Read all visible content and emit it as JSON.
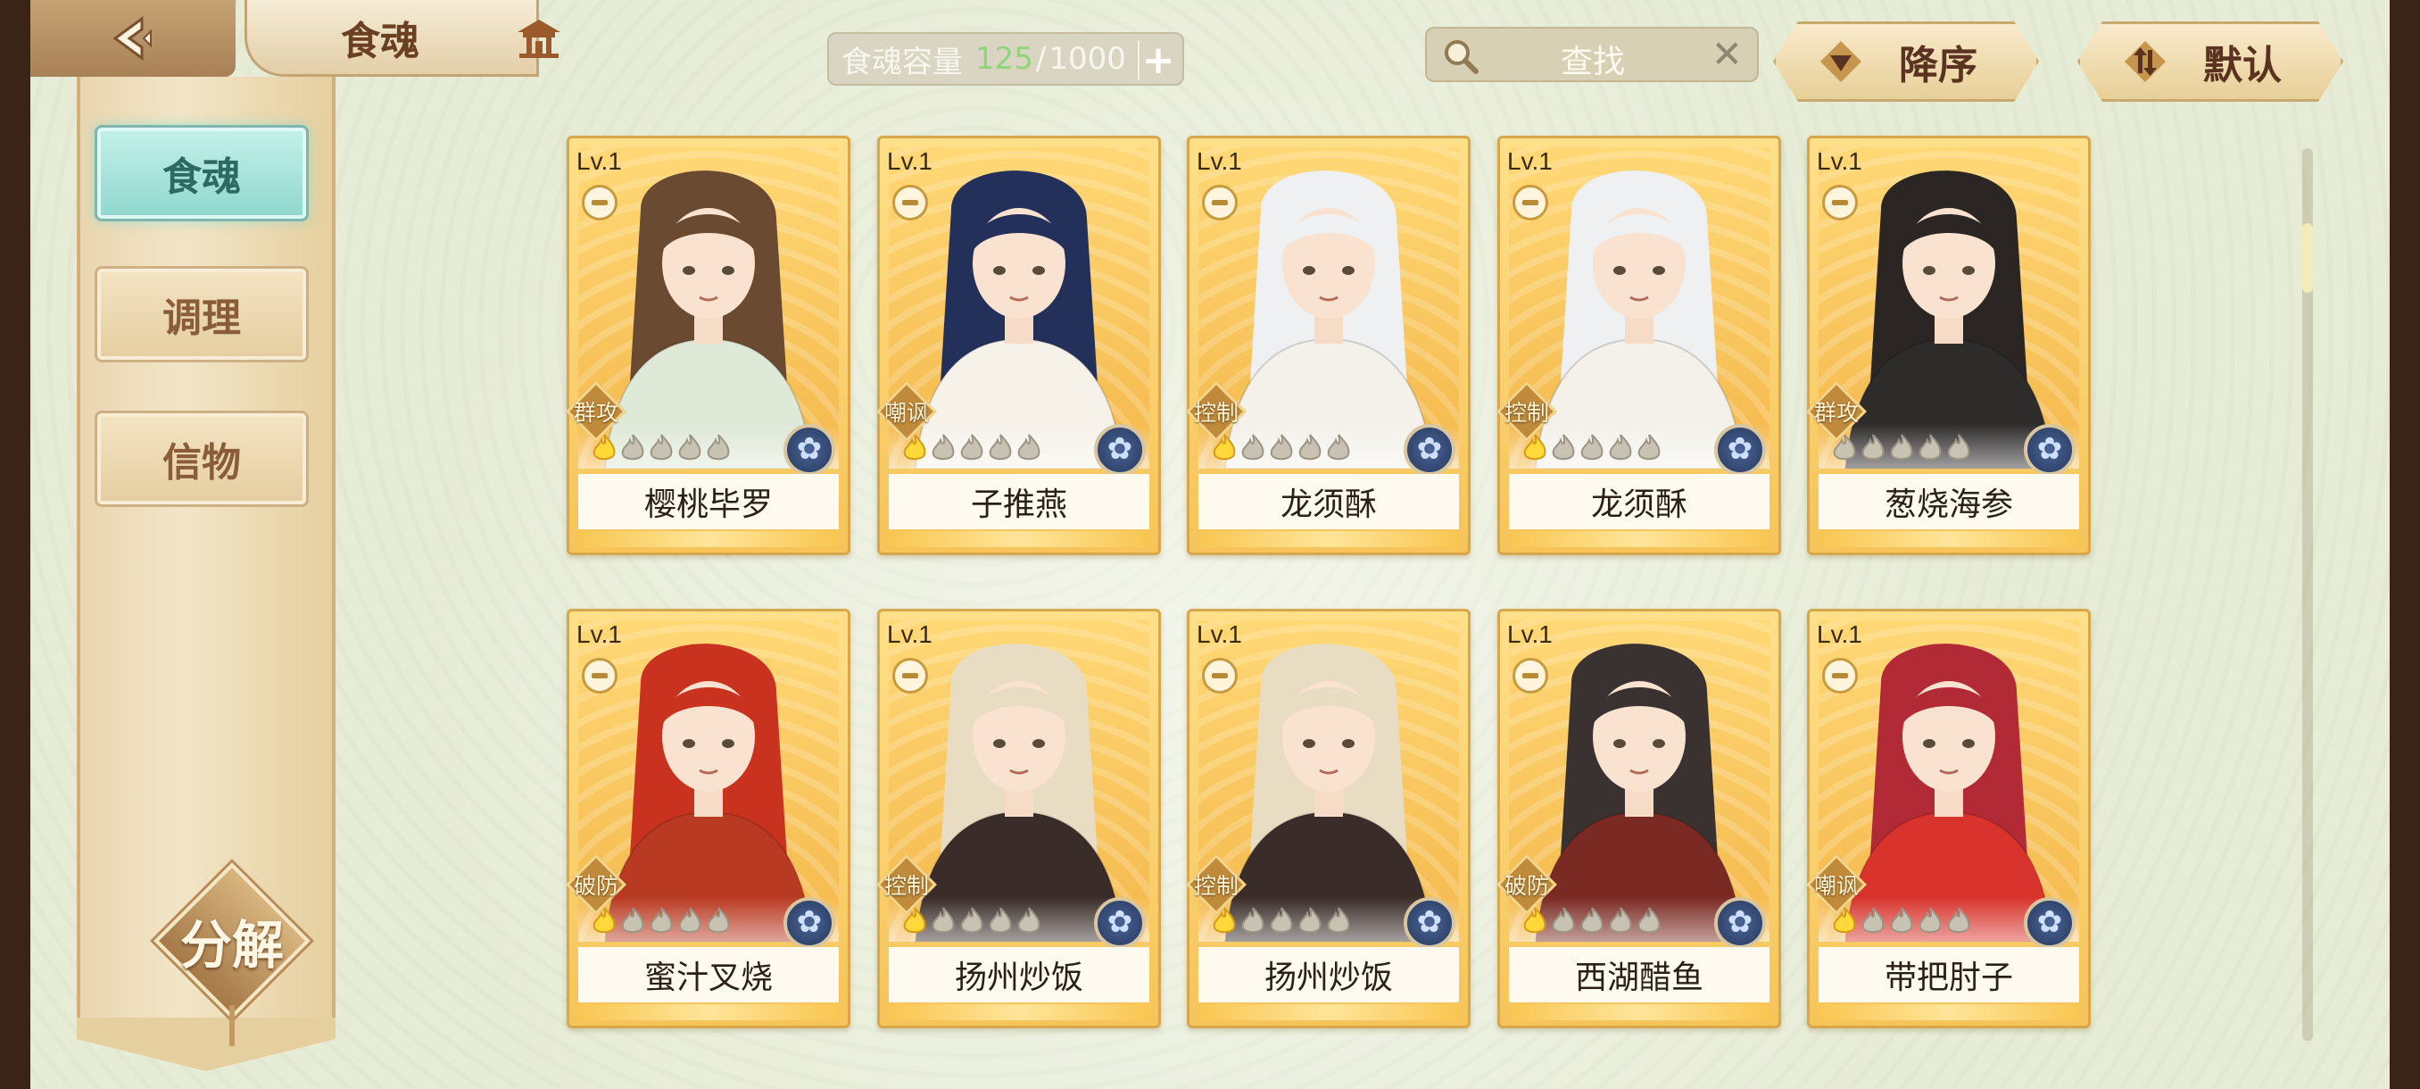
{
  "header": {
    "title": "食魂",
    "capacity": {
      "label": "食魂容量",
      "current": "125",
      "separator": "/",
      "max": "1000",
      "add_label": "+"
    },
    "search": {
      "placeholder": "查找",
      "clear_label": "✕"
    },
    "sort_order_label": "降序",
    "sort_mode_label": "默认"
  },
  "sidebar": {
    "tabs": [
      {
        "label": "食魂",
        "active": true
      },
      {
        "label": "调理",
        "active": false
      },
      {
        "label": "信物",
        "active": false
      }
    ],
    "decompose_label": "分解"
  },
  "colors": {
    "accent_teal": "#8fd7cd",
    "card_gold": "#f6c459",
    "capacity_current": "#8fd57a"
  },
  "cards": [
    {
      "level": "Lv.1",
      "role": "群攻",
      "name": "樱桃毕罗",
      "stars_lit": 1,
      "stars_total": 5,
      "hair": "#6b4a32",
      "robe": "#dfe9d7"
    },
    {
      "level": "Lv.1",
      "role": "嘲讽",
      "name": "子推燕",
      "stars_lit": 1,
      "stars_total": 5,
      "hair": "#23305a",
      "robe": "#f6f2ea"
    },
    {
      "level": "Lv.1",
      "role": "控制",
      "name": "龙须酥",
      "stars_lit": 1,
      "stars_total": 5,
      "hair": "#eef0f2",
      "robe": "#f4f1ea"
    },
    {
      "level": "Lv.1",
      "role": "控制",
      "name": "龙须酥",
      "stars_lit": 1,
      "stars_total": 5,
      "hair": "#eef0f2",
      "robe": "#f4f1ea"
    },
    {
      "level": "Lv.1",
      "role": "群攻",
      "name": "葱烧海参",
      "stars_lit": 0,
      "stars_total": 5,
      "hair": "#2b2624",
      "robe": "#2e2b2b"
    },
    {
      "level": "Lv.1",
      "role": "破防",
      "name": "蜜汁叉烧",
      "stars_lit": 1,
      "stars_total": 5,
      "hair": "#c8321f",
      "robe": "#b93a22"
    },
    {
      "level": "Lv.1",
      "role": "控制",
      "name": "扬州炒饭",
      "stars_lit": 1,
      "stars_total": 5,
      "hair": "#e8dcc2",
      "robe": "#3a2c28"
    },
    {
      "level": "Lv.1",
      "role": "控制",
      "name": "扬州炒饭",
      "stars_lit": 1,
      "stars_total": 5,
      "hair": "#e8dcc2",
      "robe": "#3a2c28"
    },
    {
      "level": "Lv.1",
      "role": "破防",
      "name": "西湖醋鱼",
      "stars_lit": 1,
      "stars_total": 5,
      "hair": "#3a3230",
      "robe": "#7a2a22"
    },
    {
      "level": "Lv.1",
      "role": "嘲讽",
      "name": "带把肘子",
      "stars_lit": 1,
      "stars_total": 5,
      "hair": "#b22a36",
      "robe": "#d8332c"
    }
  ]
}
